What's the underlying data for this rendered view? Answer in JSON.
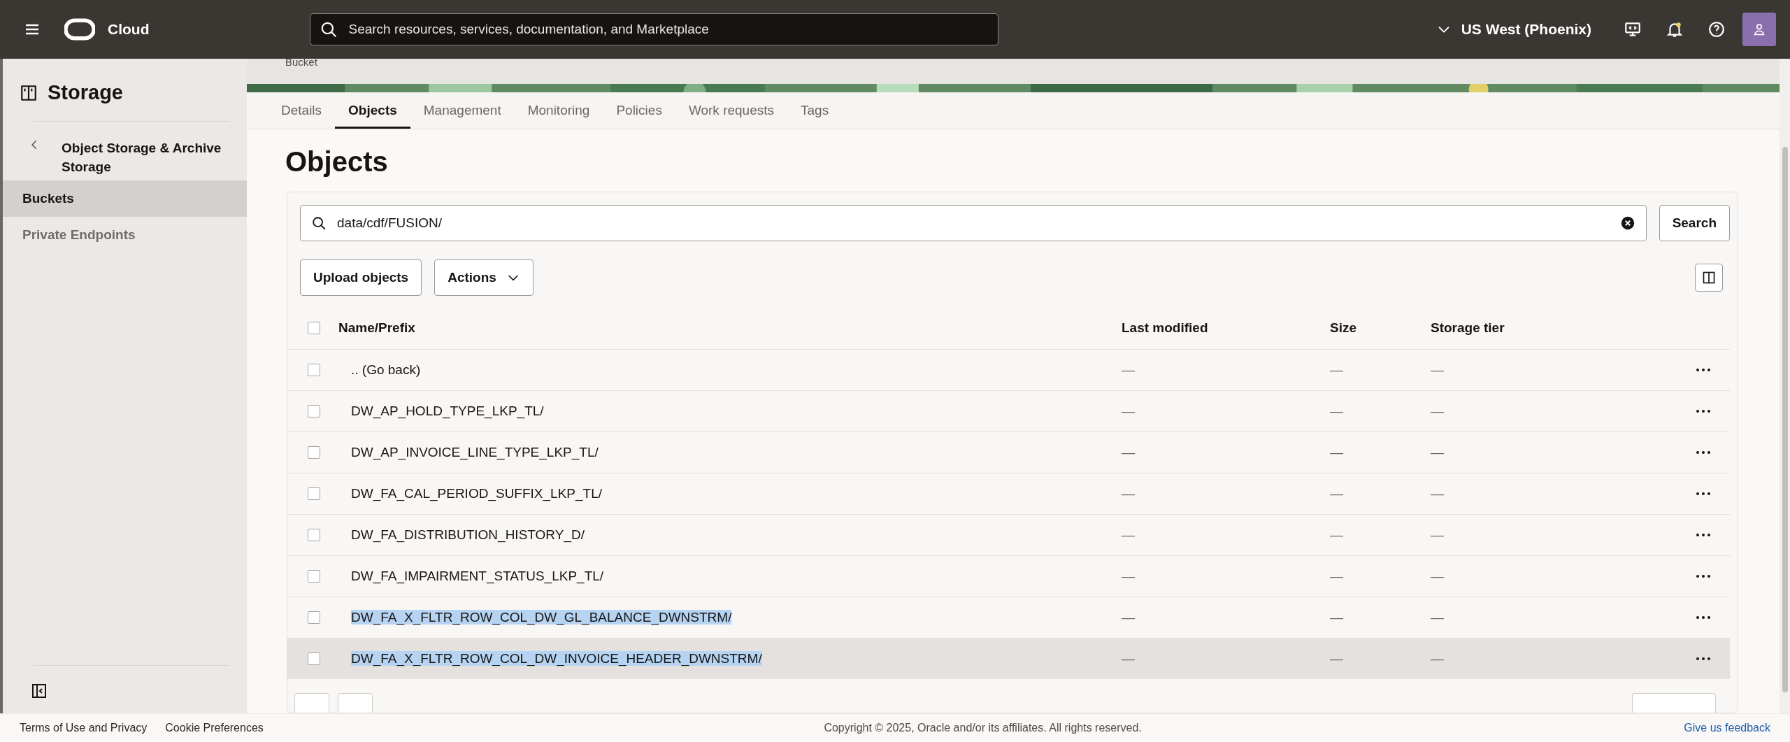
{
  "top_bar": {
    "brand": "Cloud",
    "search": {
      "placeholder": "Search resources, services, documentation, and Marketplace"
    },
    "region": "US West (Phoenix)"
  },
  "sidebar": {
    "title": "Storage",
    "back_link": "Object Storage & Archive Storage",
    "items": [
      {
        "label": "Buckets",
        "selected": true
      },
      {
        "label": "Private Endpoints",
        "selected": false
      }
    ]
  },
  "page": {
    "breadcrumb": "Bucket",
    "tabs": [
      {
        "label": "Details",
        "selected": false
      },
      {
        "label": "Objects",
        "selected": true
      },
      {
        "label": "Management",
        "selected": false
      },
      {
        "label": "Monitoring",
        "selected": false
      },
      {
        "label": "Policies",
        "selected": false
      },
      {
        "label": "Work requests",
        "selected": false
      },
      {
        "label": "Tags",
        "selected": false
      }
    ],
    "heading": "Objects",
    "filter": {
      "value": "data/cdf/FUSION/",
      "button": "Search"
    },
    "toolbar": {
      "upload": "Upload objects",
      "actions": "Actions"
    },
    "table": {
      "select_all_checked": false,
      "columns": [
        "Name/Prefix",
        "Last modified",
        "Size",
        "Storage tier"
      ],
      "rows": [
        {
          "name": ".. (Go back)",
          "last_modified": "—",
          "size": "—",
          "storage_tier": "—",
          "checked": false,
          "text_selected": false,
          "hovered": false
        },
        {
          "name": "DW_AP_HOLD_TYPE_LKP_TL/",
          "last_modified": "—",
          "size": "—",
          "storage_tier": "—",
          "checked": false,
          "text_selected": false,
          "hovered": false
        },
        {
          "name": "DW_AP_INVOICE_LINE_TYPE_LKP_TL/",
          "last_modified": "—",
          "size": "—",
          "storage_tier": "—",
          "checked": false,
          "text_selected": false,
          "hovered": false
        },
        {
          "name": "DW_FA_CAL_PERIOD_SUFFIX_LKP_TL/",
          "last_modified": "—",
          "size": "—",
          "storage_tier": "—",
          "checked": false,
          "text_selected": false,
          "hovered": false
        },
        {
          "name": "DW_FA_DISTRIBUTION_HISTORY_D/",
          "last_modified": "—",
          "size": "—",
          "storage_tier": "—",
          "checked": false,
          "text_selected": false,
          "hovered": false
        },
        {
          "name": "DW_FA_IMPAIRMENT_STATUS_LKP_TL/",
          "last_modified": "—",
          "size": "—",
          "storage_tier": "—",
          "checked": false,
          "text_selected": false,
          "hovered": false
        },
        {
          "name": "DW_FA_X_FLTR_ROW_COL_DW_GL_BALANCE_DWNSTRM/",
          "last_modified": "—",
          "size": "—",
          "storage_tier": "—",
          "checked": false,
          "text_selected": true,
          "hovered": false
        },
        {
          "name": "DW_FA_X_FLTR_ROW_COL_DW_INVOICE_HEADER_DWNSTRM/",
          "last_modified": "—",
          "size": "—",
          "storage_tier": "—",
          "checked": false,
          "text_selected": true,
          "hovered": true
        }
      ]
    }
  },
  "footer": {
    "links": [
      "Terms of Use and Privacy",
      "Cookie Preferences"
    ],
    "copyright": "Copyright © 2025, Oracle and/or its affiliates. All rights reserved.",
    "feedback": "Give us feedback"
  }
}
